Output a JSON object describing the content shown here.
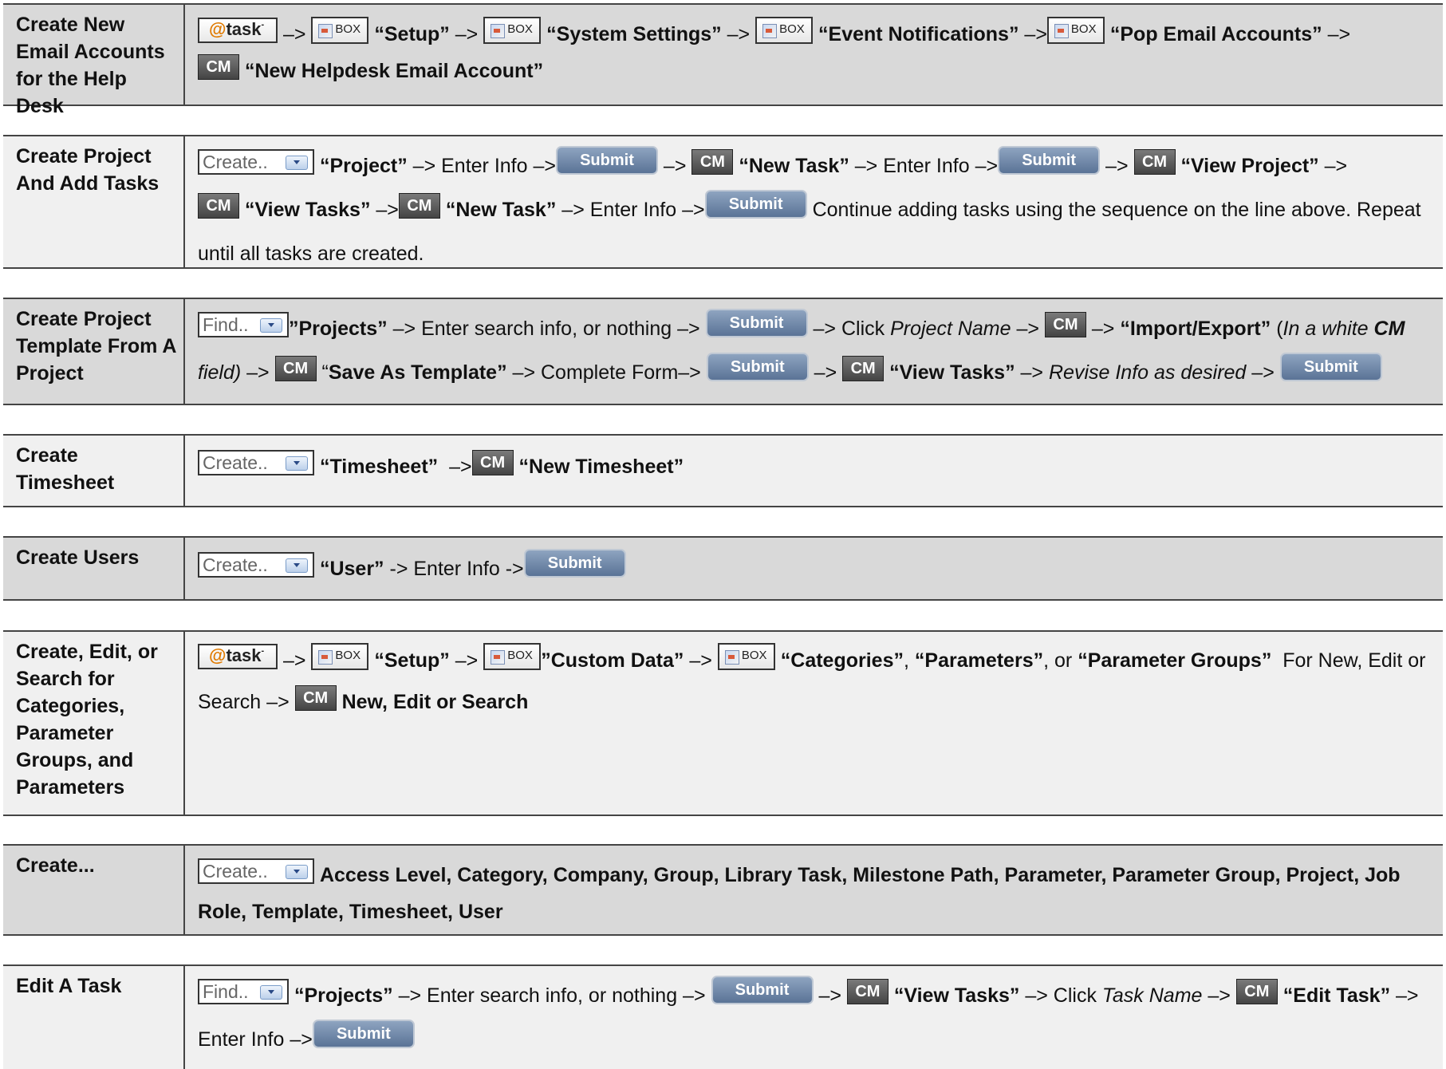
{
  "widgets": {
    "atask_text": "task",
    "atask_at": "@",
    "atask_sup": "-",
    "box_text": "BOX",
    "cm_text": "CM",
    "submit_text": "Submit",
    "create_text": "Create..",
    "find_text": "Find.."
  },
  "rows": [
    {
      "label": "Create New Email Accounts for the Help Desk",
      "setup": "“Setup”",
      "system_settings": "“System Settings”",
      "event_notifications": "“Event Notifications”",
      "pop_email": "“Pop Email Accounts”",
      "new_helpdesk": "“New Helpdesk Email Account”"
    },
    {
      "label": "Create Project And Add Tasks",
      "project": "“Project”",
      "enter_info": "Enter Info",
      "new_task": "“New Task”",
      "view_project": "“View Project”",
      "view_tasks": "“View Tasks”",
      "continue_text": "Continue adding tasks using the sequence on the line above. Repeat until all tasks are created."
    },
    {
      "label": "Create Project Template From A Project",
      "projects": "”Projects”",
      "enter_search": "Enter search info, or nothing",
      "click": "Click",
      "project_name": "Project Name",
      "import_export": "“Import/Export”",
      "in_white_pre": "In a white",
      "in_white_cm": "CM",
      "field": "field)",
      "save_as_template": "Save As Template”",
      "complete_form": "Complete Form",
      "view_tasks": "“View Tasks”",
      "revise": "Revise Info as desired"
    },
    {
      "label": "Create Timesheet",
      "timesheet": "“Timesheet”",
      "new_timesheet": "“New Timesheet”"
    },
    {
      "label": "Create Users",
      "user": "“User”",
      "enter_info": "Enter Info"
    },
    {
      "label": "Create, Edit, or Search for Categories, Parameter Groups, and Parameters",
      "setup": "“Setup”",
      "custom_data": "”Custom Data”",
      "categories": "“Categories”",
      "parameters": "“Parameters”",
      "or": ", or",
      "parameter_groups": "“Parameter Groups”",
      "for_new": "For New, Edit or Search",
      "new_edit_search": "New, Edit or Search"
    },
    {
      "label": "Create...",
      "items": "Access Level, Category, Company, Group, Library Task, Milestone Path, Parameter, Parameter Group, Project, Job Role, Template, Timesheet, User"
    },
    {
      "label": "Edit A Task",
      "projects": "“Projects”",
      "enter_search": "Enter search info, or nothing",
      "view_tasks": "“View Tasks”",
      "click": "Click",
      "task_name": "Task Name",
      "edit_task": "“Edit Task”",
      "enter_info": "Enter Info"
    }
  ]
}
